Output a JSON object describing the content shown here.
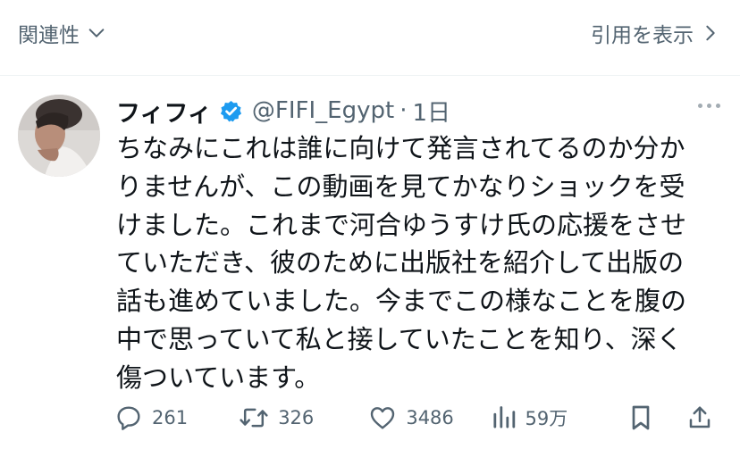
{
  "topbar": {
    "related_label": "関連性",
    "quote_label": "引用を表示"
  },
  "tweet": {
    "display_name": "フィフィ",
    "handle": "@FIFI_Egypt",
    "separator": "·",
    "time": "1日",
    "lines": [
      "ちなみにこれは誰に向けて発言されてるのか分か",
      "りませんが、この動画を見てかなりショックを受",
      "けました。これまで河合ゆうすけ氏の応援をさせ",
      "ていただき、彼のために出版社を紹介して出版の",
      "話も進めていました。今までこの様なことを腹の",
      "中で思っていて私と接していたことを知り、深く",
      "傷ついています。"
    ]
  },
  "actions": {
    "replies": "261",
    "retweets": "326",
    "likes": "3486",
    "views": "59万"
  },
  "icons": {
    "verified": "verified-badge-icon",
    "reply": "reply-icon",
    "retweet": "retweet-icon",
    "like": "heart-icon",
    "views": "views-icon",
    "bookmark": "bookmark-icon",
    "share": "share-icon"
  },
  "colors": {
    "verified": "#1d9bf0",
    "secondary_text": "#536471",
    "primary_text": "#0f1419"
  }
}
